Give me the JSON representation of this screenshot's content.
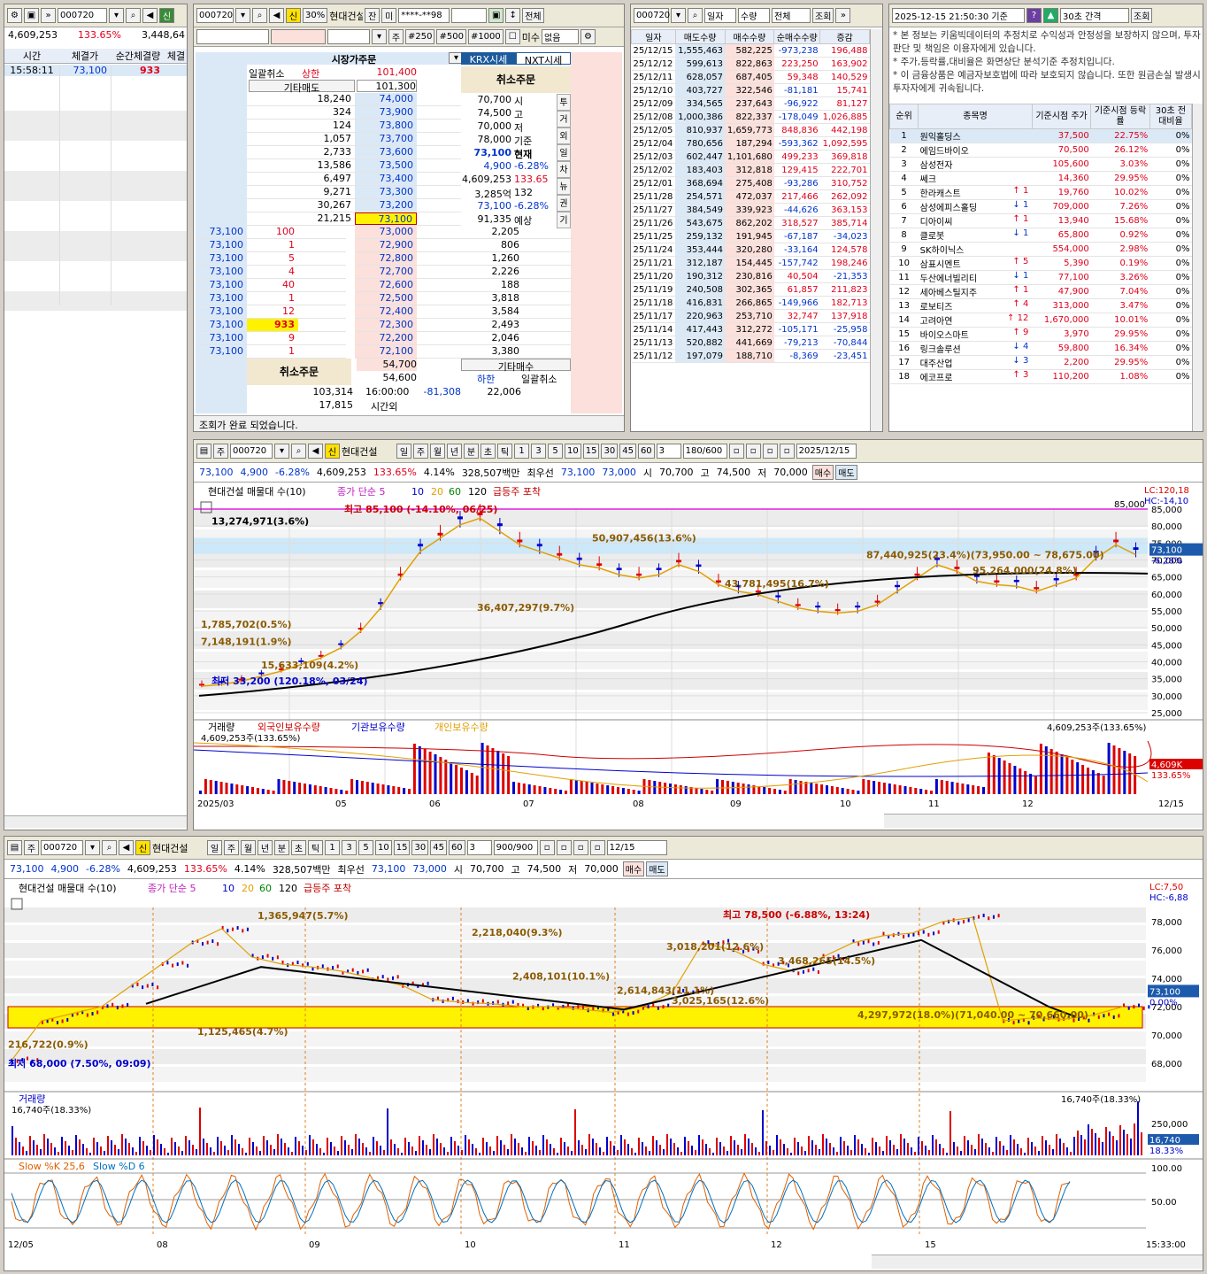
{
  "left": {
    "code": "000720",
    "volume": "4,609,253",
    "ratio": "133.65%",
    "other": "3,448,64",
    "headers": [
      "시간",
      "체결가",
      "순간체결량",
      "체결"
    ],
    "row": {
      "time": "15:58:11",
      "price": "73,100",
      "qty": "933"
    }
  },
  "order": {
    "code": "000720",
    "pct": "30%",
    "name": "현대건설",
    "tabs": [
      "잔",
      "미"
    ],
    "account": "****-**98",
    "btn_all": "전체",
    "qty_label": "주",
    "btns": [
      "#250",
      "#500",
      "#1000"
    ],
    "check": "미수",
    "sel": "없음",
    "market": "시장가주문",
    "krx": "KRX시세",
    "nxt": "NXT시세",
    "cancel_all": "일괄취소",
    "cancel_all2": "일괄취소",
    "etc_sell": "기타매도",
    "etc_buy": "기타매수",
    "cancel_order": "취소주문",
    "upper": "상한",
    "lower": "하한",
    "upper_price": "101,400",
    "bid_top": "101,300",
    "status": "조회가 완료 되었습니다.",
    "asks": [
      [
        "18,240",
        "74,000"
      ],
      [
        "324",
        "73,900"
      ],
      [
        "124",
        "73,800"
      ],
      [
        "1,057",
        "73,700"
      ],
      [
        "2,733",
        "73,600"
      ],
      [
        "13,586",
        "73,500"
      ],
      [
        "6,497",
        "73,400"
      ],
      [
        "9,271",
        "73,300"
      ],
      [
        "30,267",
        "73,200"
      ],
      [
        "21,215",
        "73,100"
      ]
    ],
    "bids": [
      [
        "73,000",
        "2,205"
      ],
      [
        "72,900",
        "806"
      ],
      [
        "72,800",
        "1,260"
      ],
      [
        "72,700",
        "2,226"
      ],
      [
        "72,600",
        "188"
      ],
      [
        "72,500",
        "3,818"
      ],
      [
        "72,400",
        "3,584"
      ],
      [
        "72,300",
        "2,493"
      ],
      [
        "72,200",
        "2,046"
      ],
      [
        "72,100",
        "3,380"
      ]
    ],
    "fills": [
      [
        "73,100",
        "100"
      ],
      [
        "73,100",
        "1"
      ],
      [
        "73,100",
        "5"
      ],
      [
        "73,100",
        "4"
      ],
      [
        "73,100",
        "40"
      ],
      [
        "73,100",
        "1"
      ],
      [
        "73,100",
        "12"
      ],
      [
        "73,100",
        "933"
      ],
      [
        "73,100",
        "9"
      ],
      [
        "73,100",
        "1"
      ]
    ],
    "info": [
      [
        "70,700",
        "시"
      ],
      [
        "74,500",
        "고"
      ],
      [
        "70,000",
        "저"
      ],
      [
        "78,000",
        "기준"
      ],
      [
        "73,100",
        "현재"
      ],
      [
        "4,900",
        "-6.28%"
      ],
      [
        "4,609,253",
        "133.65"
      ],
      [
        "3,285억",
        "132"
      ],
      [
        "73,100",
        "-6.28%"
      ],
      [
        "91,335",
        "예상"
      ]
    ],
    "side": [
      "투",
      "거",
      "외",
      "일",
      "차",
      "뉴",
      "권",
      "기"
    ],
    "low_price": "54,700",
    "low2": "54,600",
    "tot_ask": "103,314",
    "time": "16:00:00",
    "diff": "-81,308",
    "tot_bid": "22,006",
    "after": "17,815",
    "after_lbl": "시간외"
  },
  "daily": {
    "code": "000720",
    "sel1": "일자",
    "sel2": "수량",
    "sel3": "전체",
    "btn": "조회",
    "headers": [
      "일자",
      "매도수량",
      "매수수량",
      "순매수수량",
      "증감"
    ],
    "rows": [
      [
        "25/12/15",
        "1,555,463",
        "582,225",
        "-973,238",
        "196,488"
      ],
      [
        "25/12/12",
        "599,613",
        "822,863",
        "223,250",
        "163,902"
      ],
      [
        "25/12/11",
        "628,057",
        "687,405",
        "59,348",
        "140,529"
      ],
      [
        "25/12/10",
        "403,727",
        "322,546",
        "-81,181",
        "15,741"
      ],
      [
        "25/12/09",
        "334,565",
        "237,643",
        "-96,922",
        "81,127"
      ],
      [
        "25/12/08",
        "1,000,386",
        "822,337",
        "-178,049",
        "1,026,885"
      ],
      [
        "25/12/05",
        "810,937",
        "1,659,773",
        "848,836",
        "442,198"
      ],
      [
        "25/12/04",
        "780,656",
        "187,294",
        "-593,362",
        "1,092,595"
      ],
      [
        "25/12/03",
        "602,447",
        "1,101,680",
        "499,233",
        "369,818"
      ],
      [
        "25/12/02",
        "183,403",
        "312,818",
        "129,415",
        "222,701"
      ],
      [
        "25/12/01",
        "368,694",
        "275,408",
        "-93,286",
        "310,752"
      ],
      [
        "25/11/28",
        "254,571",
        "472,037",
        "217,466",
        "262,092"
      ],
      [
        "25/11/27",
        "384,549",
        "339,923",
        "-44,626",
        "363,153"
      ],
      [
        "25/11/26",
        "543,675",
        "862,202",
        "318,527",
        "385,714"
      ],
      [
        "25/11/25",
        "259,132",
        "191,945",
        "-67,187",
        "-34,023"
      ],
      [
        "25/11/24",
        "353,444",
        "320,280",
        "-33,164",
        "124,578"
      ],
      [
        "25/11/21",
        "312,187",
        "154,445",
        "-157,742",
        "198,246"
      ],
      [
        "25/11/20",
        "190,312",
        "230,816",
        "40,504",
        "-21,353"
      ],
      [
        "25/11/19",
        "240,508",
        "302,365",
        "61,857",
        "211,823"
      ],
      [
        "25/11/18",
        "416,831",
        "266,865",
        "-149,966",
        "182,713"
      ],
      [
        "25/11/17",
        "220,963",
        "253,710",
        "32,747",
        "137,918"
      ],
      [
        "25/11/14",
        "417,443",
        "312,272",
        "-105,171",
        "-25,958"
      ],
      [
        "25/11/13",
        "520,882",
        "441,669",
        "-79,213",
        "-70,844"
      ],
      [
        "25/11/12",
        "197,079",
        "188,710",
        "-8,369",
        "-23,451"
      ]
    ]
  },
  "rank": {
    "time": "2025-12-15 21:50:30 기준",
    "interval": "30초 간격",
    "btn": "조회",
    "notes": [
      "* 본 정보는 키움빅데이터의 추정치로 수익성과 안정성을 보장하지 않으며, 투자판단 및 책임은 이용자에게 있습니다.",
      "* 주가,등락률,대비율은 화면상단 분석기준 추정치입니다.",
      "* 이 금융상품은 예금자보호법에 따라 보호되지 않습니다. 또한 원금손실 발생시 투자자에게 귀속됩니다."
    ],
    "headers": [
      "순위",
      "종목명",
      "기준시점 주가",
      "기준시점 등락률",
      "30초 전 대비율"
    ],
    "rows": [
      [
        "1",
        "원익홀딩스",
        "",
        "37,500",
        "22.75%",
        "0%"
      ],
      [
        "2",
        "에임드바이오",
        "",
        "70,500",
        "26.12%",
        "0%"
      ],
      [
        "3",
        "삼성전자",
        "",
        "105,600",
        "3.03%",
        "0%"
      ],
      [
        "4",
        "쎄크",
        "",
        "14,360",
        "29.95%",
        "0%"
      ],
      [
        "5",
        "한라캐스트",
        "↑ 1",
        "19,760",
        "10.02%",
        "0%"
      ],
      [
        "6",
        "삼성에피스홀딩",
        "↓ 1",
        "709,000",
        "7.26%",
        "0%"
      ],
      [
        "7",
        "디아이씨",
        "↑ 1",
        "13,940",
        "15.68%",
        "0%"
      ],
      [
        "8",
        "클로봇",
        "↓ 1",
        "65,800",
        "0.92%",
        "0%"
      ],
      [
        "9",
        "SK하이닉스",
        "",
        "554,000",
        "2.98%",
        "0%"
      ],
      [
        "10",
        "삼표시멘트",
        "↑ 5",
        "5,390",
        "0.19%",
        "0%"
      ],
      [
        "11",
        "두산에너빌리티",
        "↓ 1",
        "77,100",
        "3.26%",
        "0%"
      ],
      [
        "12",
        "세아베스틸지주",
        "↑ 1",
        "47,900",
        "7.04%",
        "0%"
      ],
      [
        "13",
        "로보티즈",
        "↑ 4",
        "313,000",
        "3.47%",
        "0%"
      ],
      [
        "14",
        "고려아연",
        "↑ 12",
        "1,670,000",
        "10.01%",
        "0%"
      ],
      [
        "15",
        "바이오스마트",
        "↑ 9",
        "3,970",
        "29.95%",
        "0%"
      ],
      [
        "16",
        "링크솔루션",
        "↓ 4",
        "59,800",
        "16.34%",
        "0%"
      ],
      [
        "17",
        "대주산업",
        "↓ 3",
        "2,200",
        "29.95%",
        "0%"
      ],
      [
        "18",
        "에코프로",
        "↑ 3",
        "110,200",
        "1.08%",
        "0%"
      ]
    ]
  },
  "chart1": {
    "code": "000720",
    "name": "현대건설",
    "periods": [
      "일",
      "주",
      "월",
      "년",
      "분",
      "초",
      "틱"
    ],
    "nums": [
      "1",
      "3",
      "5",
      "10",
      "15",
      "30",
      "45",
      "60"
    ],
    "count": "3",
    "range": "180/600",
    "date": "2025/12/15",
    "info": [
      "73,100",
      "4,900",
      "-6.28%",
      "4,609,253",
      "133.65%",
      "4.14%",
      "328,507백만",
      "최우선",
      "73,100",
      "73,000",
      "시",
      "70,700",
      "고",
      "74,500",
      "저",
      "70,000"
    ],
    "buy": "매수",
    "sell": "매도",
    "legend": [
      "현대건설 매물대 수(10)",
      "종가 단순 5",
      "10",
      "20",
      "60",
      "120",
      "급등주 포착"
    ],
    "lc": "LC:120,18",
    "hc": "HC:-14,10",
    "ticks": [
      "85,000",
      "80,000",
      "75,000",
      "70,000",
      "65,000",
      "60,000",
      "55,000",
      "50,000",
      "45,000",
      "40,000",
      "35,000",
      "30,000",
      "25,000"
    ],
    "cur": "73,100",
    "cur_pct": "-6.28%",
    "line85": "85,000",
    "labels": [
      "13,274,971(3.6%)",
      "최고 85,100 (-14.10%, 06/25)",
      "50,907,456(13.6%)",
      "87,440,925(23.4%)(73,950.00 ~ 78,675.00)",
      "95,264,000(24.8%)",
      "43,781,495(16.7%)",
      "36,407,297(9.7%)",
      "1,785,702(0.5%)",
      "7,148,191(1.9%)",
      "15,633,109(4.2%)",
      "최저 33,200 (120.18%, 03/24)"
    ],
    "vol_legend": [
      "거래량",
      "외국인보유수량",
      "기관보유수량",
      "개인보유수량"
    ],
    "vol_label": "4,609,253주(133.65%)",
    "vol_cur": "4,609K",
    "vol_pct": "133.65%",
    "months": [
      "2025/03",
      "05",
      "06",
      "07",
      "08",
      "09",
      "10",
      "11",
      "12",
      "12/15"
    ]
  },
  "chart2": {
    "code": "000720",
    "name": "현대건설",
    "periods": [
      "일",
      "주",
      "월",
      "년",
      "분",
      "초",
      "틱"
    ],
    "nums": [
      "1",
      "3",
      "5",
      "10",
      "15",
      "30",
      "45",
      "60"
    ],
    "count": "3",
    "range": "900/900",
    "date": "12/15",
    "info": [
      "73,100",
      "4,900",
      "-6.28%",
      "4,609,253",
      "133.65%",
      "4.14%",
      "328,507백만",
      "최우선",
      "73,100",
      "73,000",
      "시",
      "70,700",
      "고",
      "74,500",
      "저",
      "70,000"
    ],
    "buy": "매수",
    "sell": "매도",
    "legend": [
      "현대건설 매물대 수(10)",
      "종가 단순 5",
      "10",
      "20",
      "60",
      "120",
      "급등주 포착"
    ],
    "lc": "LC:7,50",
    "hc": "HC:-6,88",
    "ticks": [
      "78,000",
      "76,000",
      "74,000",
      "72,000",
      "70,000",
      "68,000"
    ],
    "cur": "73,100",
    "cur_pct": "0.00%",
    "labels": [
      "1,365,947(5.7%)",
      "2,218,040(9.3%)",
      "최고 78,500 (-6.88%, 13:24)",
      "3,018,201(12.6%)",
      "3,468,265(14.5%)",
      "2,408,101(10.1%)",
      "2,614,843(11.1%)",
      "3,025,165(12.6%)",
      "4,297,972(18.0%)(71,040.00 ~ 70,660.00)",
      "1,125,465(4.7%)",
      "216,722(0.9%)",
      "최저 68,000 (7.50%, 09:09)"
    ],
    "vol_legend": "거래량",
    "vol_label": "16,740주(18.33%)",
    "vol_right": "16,740주(18.33%)",
    "vol_ticks": [
      "250,000",
      "50,000"
    ],
    "vol_cur": "16,740",
    "vol_pct": "18.33%",
    "stoch": [
      "Slow %K 25,6",
      "Slow %D 6"
    ],
    "stoch_ticks": [
      "100.00",
      "50.00"
    ],
    "days": [
      "12/05",
      "08",
      "09",
      "10",
      "11",
      "12",
      "15",
      "15:33:00"
    ]
  }
}
